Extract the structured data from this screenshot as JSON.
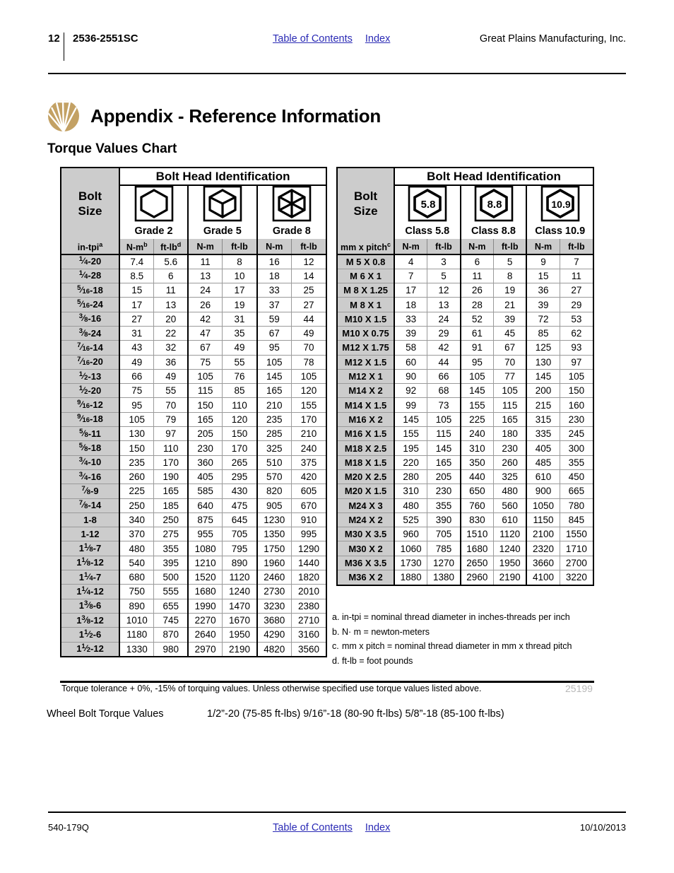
{
  "header": {
    "page_number": "12",
    "model": "2536-2551SC",
    "toc_link": "Table of Contents",
    "index_link": "Index",
    "company": "Great Plains Manufacturing, Inc."
  },
  "title": "Appendix - Reference Information",
  "subtitle": "Torque Values Chart",
  "logo_icon": "great-plains-sunburst-logo",
  "inch_table": {
    "group_header": "Bolt Head Identification",
    "size_header_line1": "Bolt",
    "size_header_line2": "Size",
    "size_unit": "in-tpi",
    "size_unit_note": "a",
    "grades": [
      {
        "label": "Grade 2",
        "icon": "hex-bolt-head-plain-icon",
        "marks": 0
      },
      {
        "label": "Grade 5",
        "icon": "hex-bolt-head-3-radial-lines-icon",
        "marks": 3
      },
      {
        "label": "Grade 8",
        "icon": "hex-bolt-head-6-radial-lines-icon",
        "marks": 6
      }
    ],
    "unit_labels": [
      "N-m",
      "ft-lb",
      "N-m",
      "ft-lb",
      "N-m",
      "ft-lb"
    ],
    "unit_notes": [
      "b",
      "d",
      "",
      "",
      "",
      ""
    ],
    "rows": [
      {
        "num": "1",
        "den": "4",
        "whole": "",
        "tpi": "-20",
        "v": [
          "7.4",
          "5.6",
          "11",
          "8",
          "16",
          "12"
        ]
      },
      {
        "num": "1",
        "den": "4",
        "whole": "",
        "tpi": "-28",
        "v": [
          "8.5",
          "6",
          "13",
          "10",
          "18",
          "14"
        ]
      },
      {
        "num": "5",
        "den": "16",
        "whole": "",
        "tpi": "-18",
        "v": [
          "15",
          "11",
          "24",
          "17",
          "33",
          "25"
        ]
      },
      {
        "num": "5",
        "den": "16",
        "whole": "",
        "tpi": "-24",
        "v": [
          "17",
          "13",
          "26",
          "19",
          "37",
          "27"
        ]
      },
      {
        "num": "3",
        "den": "8",
        "whole": "",
        "tpi": "-16",
        "v": [
          "27",
          "20",
          "42",
          "31",
          "59",
          "44"
        ]
      },
      {
        "num": "3",
        "den": "8",
        "whole": "",
        "tpi": "-24",
        "v": [
          "31",
          "22",
          "47",
          "35",
          "67",
          "49"
        ]
      },
      {
        "num": "7",
        "den": "16",
        "whole": "",
        "tpi": "-14",
        "v": [
          "43",
          "32",
          "67",
          "49",
          "95",
          "70"
        ]
      },
      {
        "num": "7",
        "den": "16",
        "whole": "",
        "tpi": "-20",
        "v": [
          "49",
          "36",
          "75",
          "55",
          "105",
          "78"
        ]
      },
      {
        "num": "1",
        "den": "2",
        "whole": "",
        "tpi": "-13",
        "v": [
          "66",
          "49",
          "105",
          "76",
          "145",
          "105"
        ]
      },
      {
        "num": "1",
        "den": "2",
        "whole": "",
        "tpi": "-20",
        "v": [
          "75",
          "55",
          "115",
          "85",
          "165",
          "120"
        ]
      },
      {
        "num": "9",
        "den": "16",
        "whole": "",
        "tpi": "-12",
        "v": [
          "95",
          "70",
          "150",
          "110",
          "210",
          "155"
        ]
      },
      {
        "num": "9",
        "den": "16",
        "whole": "",
        "tpi": "-18",
        "v": [
          "105",
          "79",
          "165",
          "120",
          "235",
          "170"
        ]
      },
      {
        "num": "5",
        "den": "8",
        "whole": "",
        "tpi": "-11",
        "v": [
          "130",
          "97",
          "205",
          "150",
          "285",
          "210"
        ]
      },
      {
        "num": "5",
        "den": "8",
        "whole": "",
        "tpi": "-18",
        "v": [
          "150",
          "110",
          "230",
          "170",
          "325",
          "240"
        ]
      },
      {
        "num": "3",
        "den": "4",
        "whole": "",
        "tpi": "-10",
        "v": [
          "235",
          "170",
          "360",
          "265",
          "510",
          "375"
        ]
      },
      {
        "num": "3",
        "den": "4",
        "whole": "",
        "tpi": "-16",
        "v": [
          "260",
          "190",
          "405",
          "295",
          "570",
          "420"
        ]
      },
      {
        "num": "7",
        "den": "8",
        "whole": "",
        "tpi": "-9",
        "v": [
          "225",
          "165",
          "585",
          "430",
          "820",
          "605"
        ]
      },
      {
        "num": "7",
        "den": "8",
        "whole": "",
        "tpi": "-14",
        "v": [
          "250",
          "185",
          "640",
          "475",
          "905",
          "670"
        ]
      },
      {
        "num": "",
        "den": "",
        "whole": "1",
        "tpi": "-8",
        "v": [
          "340",
          "250",
          "875",
          "645",
          "1230",
          "910"
        ]
      },
      {
        "num": "",
        "den": "",
        "whole": "1",
        "tpi": "-12",
        "v": [
          "370",
          "275",
          "955",
          "705",
          "1350",
          "995"
        ]
      },
      {
        "num": "1",
        "den": "8",
        "whole": "1",
        "tpi": "-7",
        "v": [
          "480",
          "355",
          "1080",
          "795",
          "1750",
          "1290"
        ]
      },
      {
        "num": "1",
        "den": "8",
        "whole": "1",
        "tpi": "-12",
        "v": [
          "540",
          "395",
          "1210",
          "890",
          "1960",
          "1440"
        ]
      },
      {
        "num": "1",
        "den": "4",
        "whole": "1",
        "tpi": "-7",
        "v": [
          "680",
          "500",
          "1520",
          "1120",
          "2460",
          "1820"
        ]
      },
      {
        "num": "1",
        "den": "4",
        "whole": "1",
        "tpi": "-12",
        "v": [
          "750",
          "555",
          "1680",
          "1240",
          "2730",
          "2010"
        ]
      },
      {
        "num": "3",
        "den": "8",
        "whole": "1",
        "tpi": "-6",
        "v": [
          "890",
          "655",
          "1990",
          "1470",
          "3230",
          "2380"
        ]
      },
      {
        "num": "3",
        "den": "8",
        "whole": "1",
        "tpi": "-12",
        "v": [
          "1010",
          "745",
          "2270",
          "1670",
          "3680",
          "2710"
        ]
      },
      {
        "num": "1",
        "den": "2",
        "whole": "1",
        "tpi": "-6",
        "v": [
          "1180",
          "870",
          "2640",
          "1950",
          "4290",
          "3160"
        ]
      },
      {
        "num": "1",
        "den": "2",
        "whole": "1",
        "tpi": "-12",
        "v": [
          "1330",
          "980",
          "2970",
          "2190",
          "4820",
          "3560"
        ]
      }
    ]
  },
  "metric_table": {
    "group_header": "Bolt Head Identification",
    "size_header_line1": "Bolt",
    "size_header_line2": "Size",
    "size_unit": "mm x pitch",
    "size_unit_note": "c",
    "grades": [
      {
        "label": "Class 5.8",
        "icon": "hex-bolt-head-marked-icon",
        "mark": "5.8"
      },
      {
        "label": "Class 8.8",
        "icon": "hex-bolt-head-marked-icon",
        "mark": "8.8"
      },
      {
        "label": "Class 10.9",
        "icon": "hex-bolt-head-marked-icon",
        "mark": "10.9"
      }
    ],
    "unit_labels": [
      "N-m",
      "ft-lb",
      "N-m",
      "ft-lb",
      "N-m",
      "ft-lb"
    ],
    "rows": [
      {
        "size": "M 5 X 0.8",
        "v": [
          "4",
          "3",
          "6",
          "5",
          "9",
          "7"
        ]
      },
      {
        "size": "M 6 X 1",
        "v": [
          "7",
          "5",
          "11",
          "8",
          "15",
          "11"
        ]
      },
      {
        "size": "M 8 X 1.25",
        "v": [
          "17",
          "12",
          "26",
          "19",
          "36",
          "27"
        ]
      },
      {
        "size": "M 8 X 1",
        "v": [
          "18",
          "13",
          "28",
          "21",
          "39",
          "29"
        ]
      },
      {
        "size": "M10 X 1.5",
        "v": [
          "33",
          "24",
          "52",
          "39",
          "72",
          "53"
        ]
      },
      {
        "size": "M10 X 0.75",
        "v": [
          "39",
          "29",
          "61",
          "45",
          "85",
          "62"
        ]
      },
      {
        "size": "M12 X 1.75",
        "v": [
          "58",
          "42",
          "91",
          "67",
          "125",
          "93"
        ]
      },
      {
        "size": "M12 X 1.5",
        "v": [
          "60",
          "44",
          "95",
          "70",
          "130",
          "97"
        ]
      },
      {
        "size": "M12 X 1",
        "v": [
          "90",
          "66",
          "105",
          "77",
          "145",
          "105"
        ]
      },
      {
        "size": "M14 X 2",
        "v": [
          "92",
          "68",
          "145",
          "105",
          "200",
          "150"
        ]
      },
      {
        "size": "M14 X 1.5",
        "v": [
          "99",
          "73",
          "155",
          "115",
          "215",
          "160"
        ]
      },
      {
        "size": "M16 X 2",
        "v": [
          "145",
          "105",
          "225",
          "165",
          "315",
          "230"
        ]
      },
      {
        "size": "M16 X 1.5",
        "v": [
          "155",
          "115",
          "240",
          "180",
          "335",
          "245"
        ]
      },
      {
        "size": "M18 X 2.5",
        "v": [
          "195",
          "145",
          "310",
          "230",
          "405",
          "300"
        ]
      },
      {
        "size": "M18 X 1.5",
        "v": [
          "220",
          "165",
          "350",
          "260",
          "485",
          "355"
        ]
      },
      {
        "size": "M20 X 2.5",
        "v": [
          "280",
          "205",
          "440",
          "325",
          "610",
          "450"
        ]
      },
      {
        "size": "M20 X 1.5",
        "v": [
          "310",
          "230",
          "650",
          "480",
          "900",
          "665"
        ]
      },
      {
        "size": "M24 X 3",
        "v": [
          "480",
          "355",
          "760",
          "560",
          "1050",
          "780"
        ]
      },
      {
        "size": "M24 X 2",
        "v": [
          "525",
          "390",
          "830",
          "610",
          "1150",
          "845"
        ]
      },
      {
        "size": "M30 X 3.5",
        "v": [
          "960",
          "705",
          "1510",
          "1120",
          "2100",
          "1550"
        ]
      },
      {
        "size": "M30 X 2",
        "v": [
          "1060",
          "785",
          "1680",
          "1240",
          "2320",
          "1710"
        ]
      },
      {
        "size": "M36 X 3.5",
        "v": [
          "1730",
          "1270",
          "2650",
          "1950",
          "3660",
          "2700"
        ]
      },
      {
        "size": "M36 X 2",
        "v": [
          "1880",
          "1380",
          "2960",
          "2190",
          "4100",
          "3220"
        ]
      }
    ]
  },
  "footnotes": [
    {
      "key": "a.",
      "text": "in-tpi = nominal thread diameter in inches-threads per inch"
    },
    {
      "key": "b.",
      "text": "N· m = newton-meters"
    },
    {
      "key": "c.",
      "text": "mm x pitch = nominal thread diameter in mm x thread  pitch"
    },
    {
      "key": "d.",
      "text": "ft-lb = foot pounds"
    }
  ],
  "tolerance_note": "Torque tolerance + 0%, -15% of torquing values. Unless otherwise specified use torque values listed above.",
  "doc_number": "25199",
  "wheel_bolt": {
    "label": "Wheel Bolt Torque Values",
    "value": "1/2”-20 (75-85 ft-lbs) 9/16”-18 (80-90 ft-lbs) 5/8”-18 (85-100 ft-lbs)"
  },
  "footer": {
    "doc_code": "540-179Q",
    "toc_link": "Table of Contents",
    "index_link": "Index",
    "date": "10/10/2013"
  },
  "colors": {
    "link": "#2a2ab5",
    "header_fill": "#cccccc",
    "logo_gold": "#c3a164",
    "doc_number": "#b8b8b8"
  }
}
